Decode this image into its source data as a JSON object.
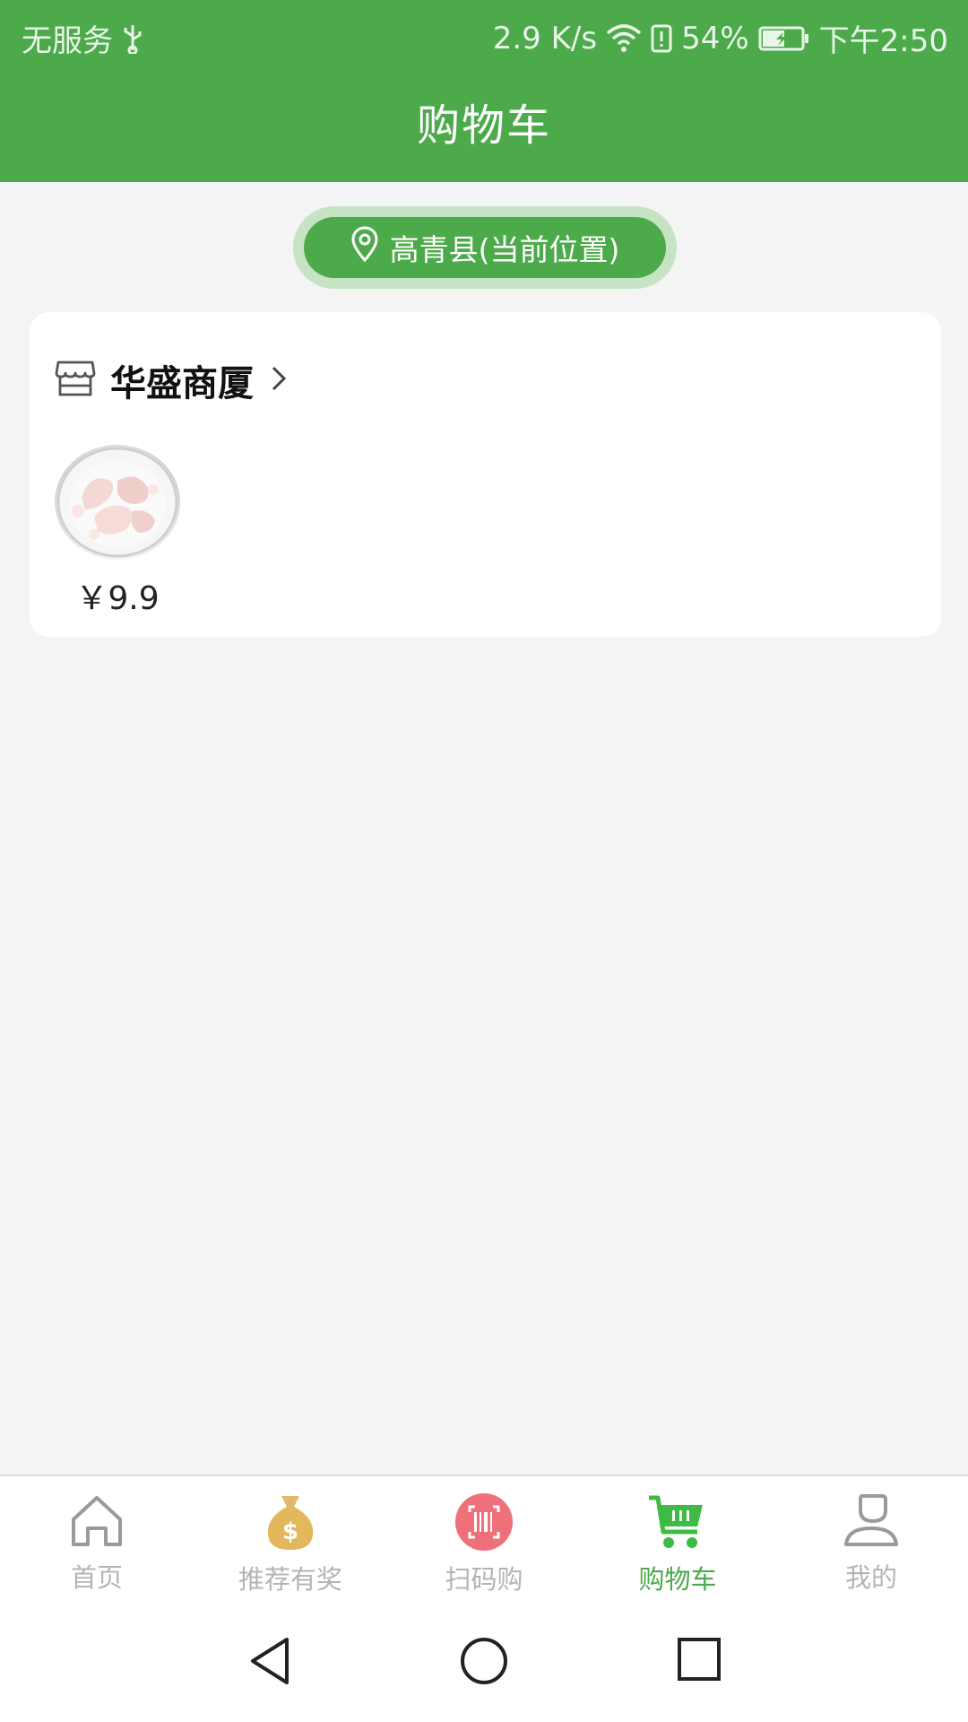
{
  "status_bar": {
    "carrier": "无服务",
    "net_speed": "2.9 K/s",
    "battery": "54%",
    "time": "下午2:50"
  },
  "header": {
    "title": "购物车"
  },
  "location": {
    "label": "高青县(当前位置)"
  },
  "store": {
    "name": "华盛商厦",
    "items": [
      {
        "price": "￥9.9"
      }
    ]
  },
  "tabs": [
    {
      "label": "首页",
      "icon": "home-icon"
    },
    {
      "label": "推荐有奖",
      "icon": "money-bag-icon"
    },
    {
      "label": "扫码购",
      "icon": "barcode-scan-icon"
    },
    {
      "label": "购物车",
      "icon": "cart-icon",
      "active": true
    },
    {
      "label": "我的",
      "icon": "profile-icon"
    }
  ],
  "colors": {
    "accent": "#4caa4b",
    "inactive": "#b4b4b4",
    "background": "#f4f4f4"
  }
}
